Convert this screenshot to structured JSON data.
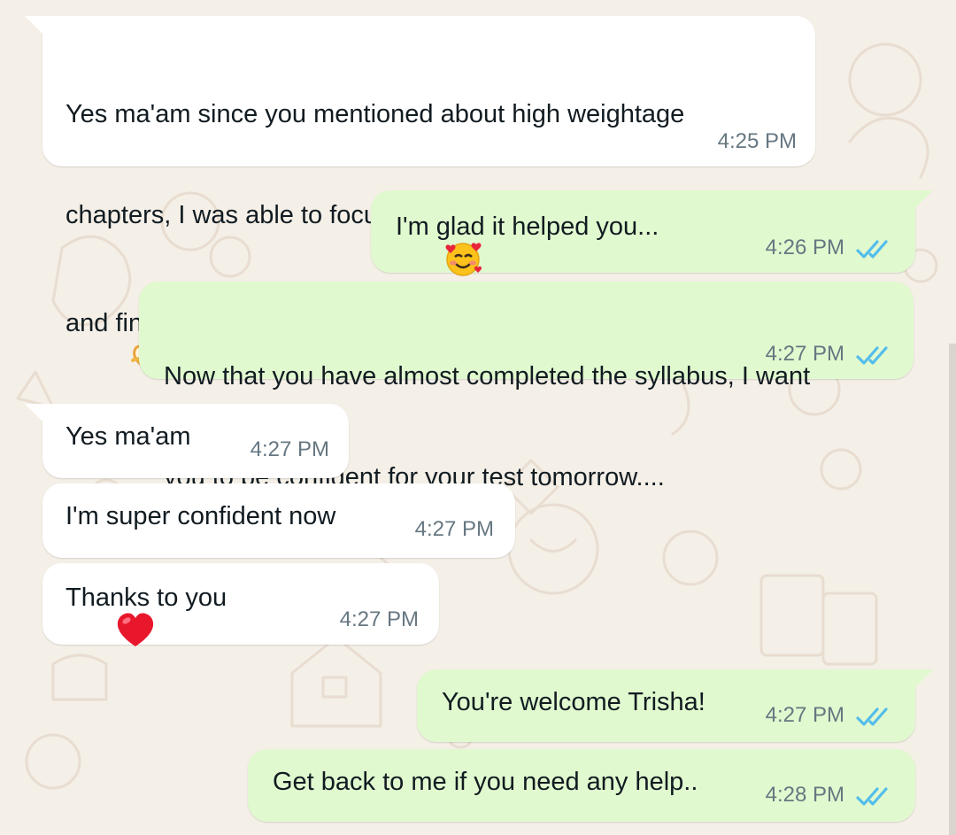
{
  "chat": {
    "messages": [
      {
        "direction": "incoming",
        "text_lines": [
          "Yes ma'am since you mentioned about high weightage",
          "chapters, I was able to focus on all the important topics",
          "and finished 90% of my syllabus sooner"
        ],
        "emojis": [
          "heart-hands-emoji",
          "pleading-face-emoji"
        ],
        "time": "4:25 PM"
      },
      {
        "direction": "outgoing",
        "text": "I'm glad it helped you...",
        "emojis": [
          "smiling-face-with-hearts-emoji"
        ],
        "time": "4:26 PM",
        "status": "read"
      },
      {
        "direction": "outgoing",
        "text_lines": [
          "Now that you have almost completed the syllabus, I want",
          "you to be confident for your test tomorrow...."
        ],
        "time": "4:27 PM",
        "status": "read"
      },
      {
        "direction": "incoming",
        "text": "Yes ma'am",
        "time": "4:27 PM"
      },
      {
        "direction": "incoming",
        "text": "I'm super confident now",
        "time": "4:27 PM"
      },
      {
        "direction": "incoming",
        "text": "Thanks to you",
        "emojis": [
          "red-heart-emoji"
        ],
        "time": "4:27 PM"
      },
      {
        "direction": "outgoing",
        "text": "You're welcome Trisha!",
        "time": "4:27 PM",
        "status": "read"
      },
      {
        "direction": "outgoing",
        "text": "Get back to me if you need any help..",
        "time": "4:28 PM",
        "status": "read"
      }
    ]
  },
  "colors": {
    "incoming_bubble": "#ffffff",
    "outgoing_bubble": "#e1f9cf",
    "read_ticks": "#53bdeb",
    "wallpaper": "#f4efe7",
    "timestamp": "#667781"
  }
}
